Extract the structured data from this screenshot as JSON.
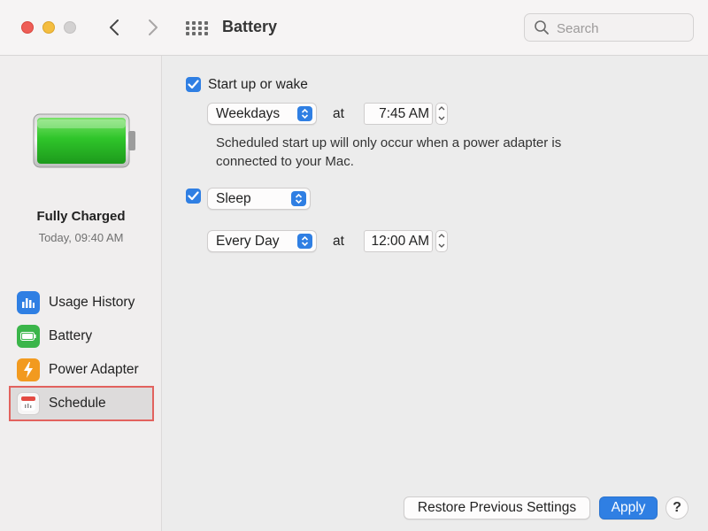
{
  "window": {
    "title": "Battery",
    "search_placeholder": "Search",
    "icons": {
      "back": "chevron-left-icon",
      "forward": "chevron-right-icon",
      "grid": "grid-icon",
      "search": "search-icon"
    }
  },
  "sidebar": {
    "battery_level": 1.0,
    "status_title": "Fully Charged",
    "status_time": "Today, 09:40 AM",
    "items": [
      {
        "label": "Usage History",
        "icon": "bar-chart-icon",
        "color": "#2f7fe3"
      },
      {
        "label": "Battery",
        "icon": "battery-icon",
        "color": "#3bb54a"
      },
      {
        "label": "Power Adapter",
        "icon": "lightning-bolt-icon",
        "color": "#f29a1f"
      },
      {
        "label": "Schedule",
        "icon": "calendar-icon",
        "color": "#e34b43",
        "selected": true
      }
    ]
  },
  "schedule": {
    "startup": {
      "checked": true,
      "label": "Start up or wake",
      "repeat": "Weekdays",
      "at_label": "at",
      "time": "7:45 AM",
      "note": "Scheduled start up will only occur when a power adapter is connected to your Mac."
    },
    "sleep": {
      "checked": true,
      "action": "Sleep",
      "repeat": "Every Day",
      "at_label": "at",
      "time": "12:00 AM"
    }
  },
  "footer": {
    "restore_label": "Restore Previous Settings",
    "apply_label": "Apply",
    "help_label": "?"
  },
  "colors": {
    "accent": "#2f7fe3",
    "selection_outline": "#e2625e"
  }
}
